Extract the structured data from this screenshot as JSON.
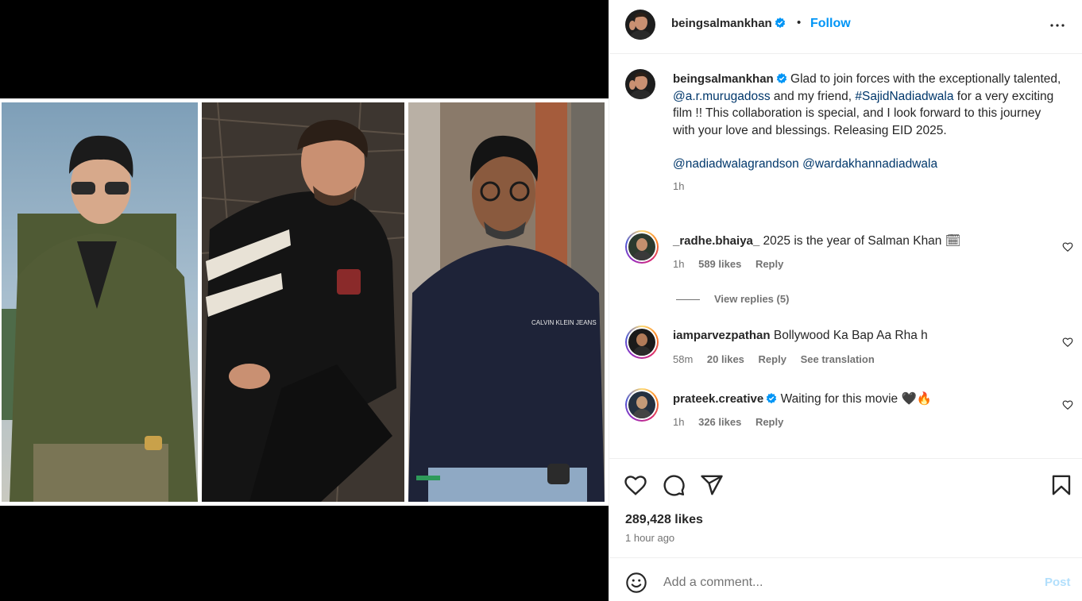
{
  "post": {
    "username": "beingsalmankhan",
    "follow_label": "Follow",
    "dot": "•"
  },
  "caption": {
    "username": "beingsalmankhan",
    "text_1": "Glad to join forces with the exceptionally talented, ",
    "mention_1": "@a.r.murugadoss",
    "text_2": " and my friend, ",
    "hashtag": "#SajidNadiadwala",
    "text_3": " for a very exciting film !! This collaboration is special, and I look forward to this journey with your love and blessings. Releasing EID 2025.",
    "mention_2": "@nadiadwalagrandson",
    "mention_3": "@wardakhannadiadwala",
    "time": "1h"
  },
  "comments": [
    {
      "username": "_radhe.bhaiya_",
      "text": "2025 is the year of Salman Khan 🗓",
      "time": "1h",
      "likes": "589 likes",
      "reply": "Reply",
      "extra": ""
    },
    {
      "username": "iamparvezpathan",
      "text": "Bollywood Ka Bap Aa Rha h",
      "time": "58m",
      "likes": "20 likes",
      "reply": "Reply",
      "extra": "See translation"
    },
    {
      "username": "prateek.creative",
      "text": "Waiting for this movie 🖤🔥",
      "time": "1h",
      "likes": "326 likes",
      "reply": "Reply",
      "extra": ""
    }
  ],
  "view_replies": "View replies (5)",
  "likes": "289,428 likes",
  "posted_time": "1 hour ago",
  "comment_box": {
    "placeholder": "Add a comment...",
    "post_label": "Post"
  },
  "colors": {
    "accent": "#0095f6",
    "link": "#00376b",
    "muted": "#737373",
    "post_disabled": "#b2dffc"
  }
}
